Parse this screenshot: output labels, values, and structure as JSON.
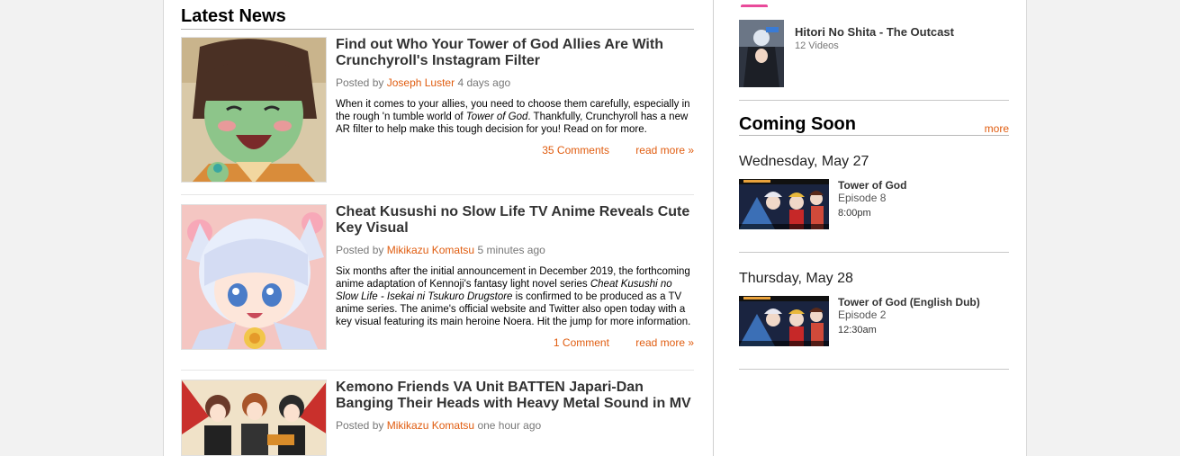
{
  "latest_news": {
    "title": "Latest News",
    "articles": [
      {
        "title": "Find out Who Your Tower of God Allies Are With Crunchyroll's Instagram Filter",
        "posted_by": "Posted by",
        "author": "Joseph Luster",
        "time": "4 days ago",
        "text_1": "When it comes to your allies, you need to choose them carefully, especially in the rough 'n tumble world of ",
        "text_italic": "Tower of God",
        "text_2": ". Thankfully, Crunchyroll has a new AR filter to help make this tough decision for you! Read on for more.",
        "comments": "35 Comments",
        "read_more": "read more »"
      },
      {
        "title": "Cheat Kusushi no Slow Life TV Anime Reveals Cute Key Visual",
        "posted_by": "Posted by",
        "author": "Mikikazu Komatsu",
        "time": "5 minutes ago",
        "text_1": "Six months after the initial announcement in December 2019, the forthcoming anime adaptation of Kennoji's fantasy light novel series ",
        "text_italic": "Cheat Kusushi no Slow Life - Isekai ni Tsukuro Drugstore",
        "text_2": " is confirmed to be produced as a TV anime series. The anime's official website and Twitter also open today with a key visual featuring its main heroine Noera. Hit the jump for more information.",
        "comments": "1 Comment",
        "read_more": "read more »"
      },
      {
        "title": "Kemono Friends VA Unit BATTEN Japari-Dan Banging Their Heads with Heavy Metal Sound in MV",
        "posted_by": "Posted by",
        "author": "Mikikazu Komatsu",
        "time": "one hour ago"
      }
    ]
  },
  "sidebar": {
    "show": {
      "title": "Hitori No Shita - The Outcast",
      "count": "12 Videos"
    },
    "coming_soon": {
      "title": "Coming Soon",
      "more": "more",
      "days": [
        {
          "day": "Wednesday, May 27",
          "title": "Tower of God",
          "episode": "Episode 8",
          "time": "8:00pm"
        },
        {
          "day": "Thursday, May 28",
          "title": "Tower of God (English Dub)",
          "episode": "Episode 2",
          "time": "12:30am"
        }
      ]
    }
  },
  "colors": {
    "accent": "#e05c0f",
    "page_bg": "#f2f2f2"
  }
}
